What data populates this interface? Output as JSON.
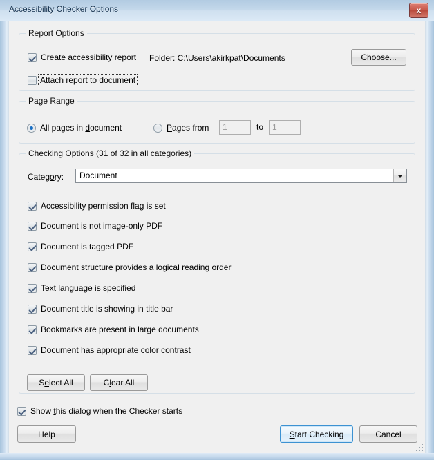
{
  "window": {
    "title": "Accessibility Checker Options",
    "close_label": "✕",
    "close_glyph": "x"
  },
  "report_options": {
    "legend": "Report Options",
    "create_report": {
      "label_pre": "Create accessibility ",
      "label_acc": "r",
      "label_post": "eport",
      "full_label": "Create accessibility report",
      "checked": true
    },
    "folder_text": "Folder: C:\\Users\\akirkpat\\Documents",
    "choose_button": {
      "acc": "C",
      "post": "hoose...",
      "full_label": "Choose..."
    },
    "attach_report": {
      "acc": "A",
      "post": "ttach report to document",
      "full_label": "Attach report to document",
      "checked": false,
      "focused": true
    }
  },
  "page_range": {
    "legend": "Page Range",
    "all_pages": {
      "pre": "All pages in ",
      "acc": "d",
      "post": "ocument",
      "full_label": "All pages in document",
      "selected": true
    },
    "pages_from": {
      "acc": "P",
      "post": "ages from",
      "full_label": "Pages from",
      "selected": false
    },
    "from_value": "1",
    "to_label": "to",
    "to_value": "1"
  },
  "checking_options": {
    "legend": "Checking Options (31 of 32 in all categories)",
    "category_label": "Categ",
    "category_label_acc": "o",
    "category_label_post": "ry:",
    "category_label_full": "Category:",
    "category_value": "Document",
    "category_options": [
      "Document"
    ],
    "items": [
      {
        "label": "Accessibility permission flag is set",
        "checked": true
      },
      {
        "label": "Document is not image-only PDF",
        "checked": true
      },
      {
        "label": "Document is tagged PDF",
        "checked": true
      },
      {
        "label": "Document structure provides a logical reading order",
        "checked": true
      },
      {
        "label": "Text language is specified",
        "checked": true
      },
      {
        "label": "Document title is showing in title bar",
        "checked": true
      },
      {
        "label": "Bookmarks are present in large documents",
        "checked": true
      },
      {
        "label": "Document has appropriate color contrast",
        "checked": true
      }
    ],
    "select_all": {
      "pre": "S",
      "acc": "e",
      "post": "lect All",
      "full_label": "Select All"
    },
    "clear_all": {
      "pre": "C",
      "acc": "l",
      "post": "ear All",
      "full_label": "Clear All"
    }
  },
  "footer": {
    "show_dialog": {
      "pre": "Show ",
      "acc": "t",
      "post": "his dialog when the Checker starts",
      "full_label": "Show this dialog when the Checker starts",
      "checked": true
    },
    "help_button": "Help",
    "start_button": {
      "acc": "S",
      "post": "tart Checking",
      "full_label": "Start Checking"
    },
    "cancel_button": "Cancel"
  },
  "colors": {
    "title_text": "#14314f",
    "dialog_bg": "#f0f0f0",
    "accent_blue": "#1a6fc4",
    "close_red": "#c85a4c",
    "default_button_border": "#3c92d2"
  }
}
